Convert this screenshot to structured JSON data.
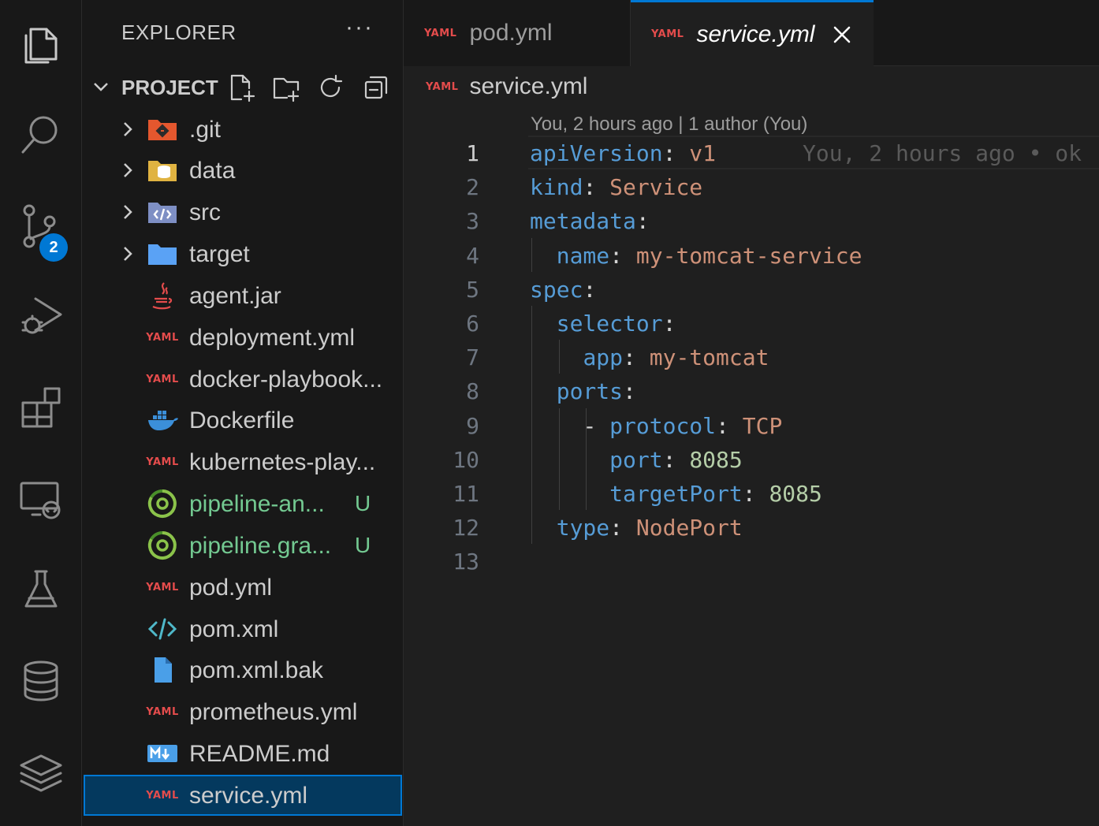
{
  "activity_bar": {
    "items": [
      {
        "name": "explorer-icon"
      },
      {
        "name": "search-icon"
      },
      {
        "name": "source-control-icon",
        "badge": "2"
      },
      {
        "name": "run-debug-icon"
      },
      {
        "name": "extensions-icon"
      },
      {
        "name": "remote-explorer-icon"
      },
      {
        "name": "testing-icon"
      },
      {
        "name": "database-icon"
      },
      {
        "name": "layers-icon"
      }
    ]
  },
  "sidebar": {
    "title": "EXPLORER",
    "more": "···",
    "project": "PROJECT",
    "items": [
      {
        "label": ".git",
        "icon": "git-folder-icon",
        "folder": true
      },
      {
        "label": "data",
        "icon": "database-folder-icon",
        "folder": true
      },
      {
        "label": "src",
        "icon": "src-folder-icon",
        "folder": true
      },
      {
        "label": "target",
        "icon": "folder-icon",
        "folder": true
      },
      {
        "label": "agent.jar",
        "icon": "java-icon"
      },
      {
        "label": "deployment.yml",
        "icon": "yaml-icon"
      },
      {
        "label": "docker-playbook...",
        "icon": "yaml-icon"
      },
      {
        "label": "Dockerfile",
        "icon": "docker-icon"
      },
      {
        "label": "kubernetes-play...",
        "icon": "yaml-icon"
      },
      {
        "label": "pipeline-an...",
        "icon": "circleci-icon",
        "status": "U"
      },
      {
        "label": "pipeline.gra...",
        "icon": "circleci-icon",
        "status": "U"
      },
      {
        "label": "pod.yml",
        "icon": "yaml-icon"
      },
      {
        "label": "pom.xml",
        "icon": "xml-icon"
      },
      {
        "label": "pom.xml.bak",
        "icon": "file-icon"
      },
      {
        "label": "prometheus.yml",
        "icon": "yaml-icon"
      },
      {
        "label": "README.md",
        "icon": "markdown-icon"
      },
      {
        "label": "service.yml",
        "icon": "yaml-icon",
        "selected": true
      }
    ]
  },
  "yaml_tag": "YAML",
  "tabs": [
    {
      "label": "pod.yml",
      "active": false
    },
    {
      "label": "service.yml",
      "active": true
    }
  ],
  "breadcrumb": "service.yml",
  "editor": {
    "codelens": "You, 2 hours ago | 1 author (You)",
    "inline_blame": "You, 2 hours ago • ok",
    "current_line": 1,
    "line_numbers": [
      "1",
      "2",
      "3",
      "4",
      "5",
      "6",
      "7",
      "8",
      "9",
      "10",
      "11",
      "12",
      "13"
    ],
    "lines": [
      {
        "indent": "",
        "dash": "",
        "key": "apiVersion",
        "value": "v1",
        "value_type": "string"
      },
      {
        "indent": "",
        "dash": "",
        "key": "kind",
        "value": "Service",
        "value_type": "string"
      },
      {
        "indent": "",
        "dash": "",
        "key": "metadata",
        "value": "",
        "value_type": "none"
      },
      {
        "indent": "  ",
        "dash": "",
        "key": "name",
        "value": "my-tomcat-service",
        "value_type": "string"
      },
      {
        "indent": "",
        "dash": "",
        "key": "spec",
        "value": "",
        "value_type": "none"
      },
      {
        "indent": "  ",
        "dash": "",
        "key": "selector",
        "value": "",
        "value_type": "none"
      },
      {
        "indent": "    ",
        "dash": "",
        "key": "app",
        "value": "my-tomcat",
        "value_type": "string"
      },
      {
        "indent": "  ",
        "dash": "",
        "key": "ports",
        "value": "",
        "value_type": "none"
      },
      {
        "indent": "    ",
        "dash": "- ",
        "key": "protocol",
        "value": "TCP",
        "value_type": "string"
      },
      {
        "indent": "      ",
        "dash": "",
        "key": "port",
        "value": "8085",
        "value_type": "number"
      },
      {
        "indent": "      ",
        "dash": "",
        "key": "targetPort",
        "value": "8085",
        "value_type": "number"
      },
      {
        "indent": "  ",
        "dash": "",
        "key": "type",
        "value": "NodePort",
        "value_type": "string"
      },
      {
        "indent": "",
        "dash": "",
        "key": "",
        "value": "",
        "value_type": "none"
      }
    ]
  }
}
